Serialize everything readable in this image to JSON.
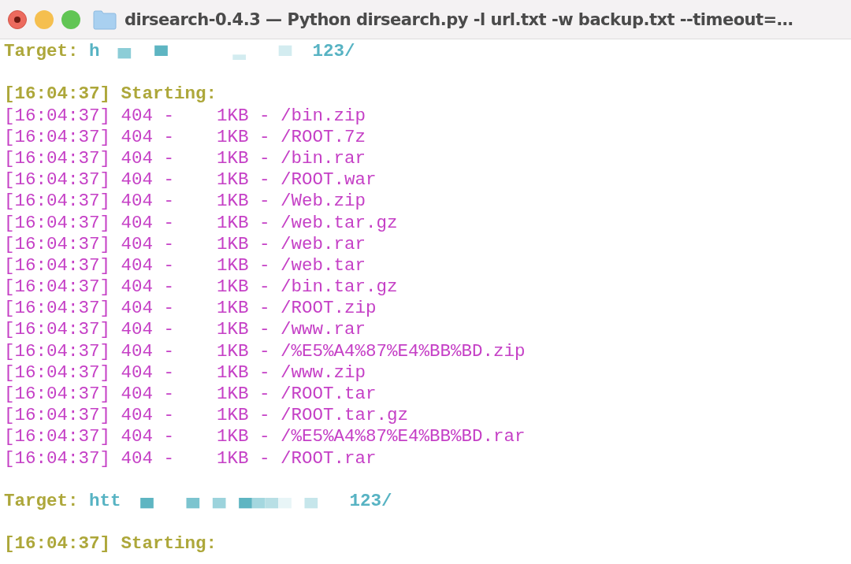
{
  "window": {
    "title": "dirsearch-0.4.3 — Python dirsearch.py -l url.txt -w backup.txt --timeout=…"
  },
  "blocks": [
    {
      "target": {
        "label": "Target:",
        "url_start": "h",
        "url_end": "123/"
      },
      "starting": "[16:04:37] Starting:",
      "lines": [
        "[16:04:37] 404 -    1KB - /bin.zip",
        "[16:04:37] 404 -    1KB - /ROOT.7z",
        "[16:04:37] 404 -    1KB - /bin.rar",
        "[16:04:37] 404 -    1KB - /ROOT.war",
        "[16:04:37] 404 -    1KB - /Web.zip",
        "[16:04:37] 404 -    1KB - /web.tar.gz",
        "[16:04:37] 404 -    1KB - /web.rar",
        "[16:04:37] 404 -    1KB - /web.tar",
        "[16:04:37] 404 -    1KB - /bin.tar.gz",
        "[16:04:37] 404 -    1KB - /ROOT.zip",
        "[16:04:37] 404 -    1KB - /www.rar",
        "[16:04:37] 404 -    1KB - /%E5%A4%87%E4%BB%BD.zip",
        "[16:04:37] 404 -    1KB - /www.zip",
        "[16:04:37] 404 -    1KB - /ROOT.tar",
        "[16:04:37] 404 -    1KB - /ROOT.tar.gz",
        "[16:04:37] 404 -    1KB - /%E5%A4%87%E4%BB%BD.rar",
        "[16:04:37] 404 -    1KB - /ROOT.rar"
      ]
    },
    {
      "target": {
        "label": "Target:",
        "url_start": "htt",
        "url_end": "123/"
      },
      "starting": "[16:04:37] Starting:"
    }
  ]
}
